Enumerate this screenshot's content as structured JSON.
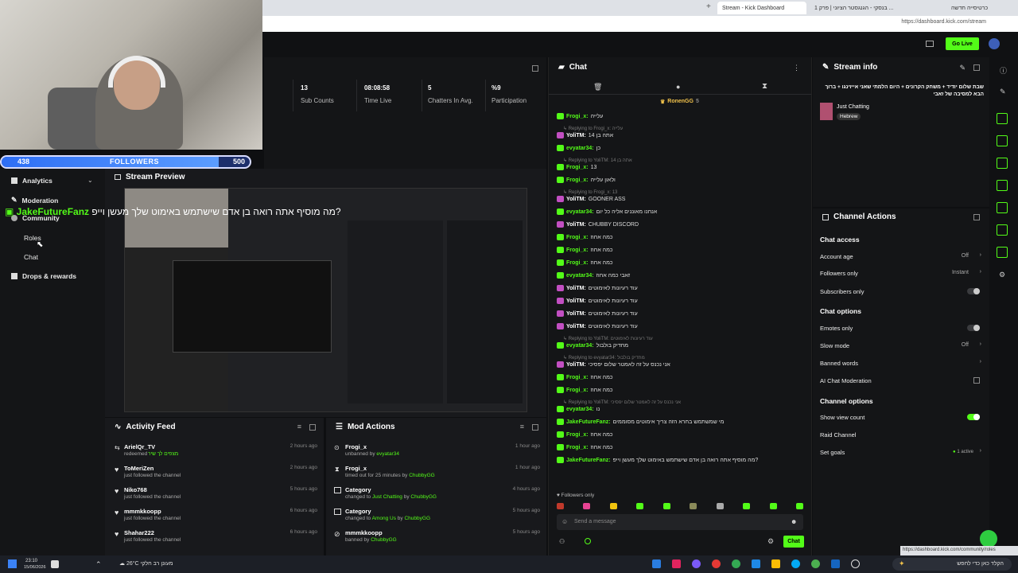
{
  "browser": {
    "tabs": [
      {
        "label": "Stream - Kick Dashboard",
        "active": true
      },
      {
        "label": "בנסקי - הגנגסטר הציוני | פרק 1 ...",
        "active": false
      },
      {
        "label": "כרטיסייה חדשה",
        "active": false
      }
    ],
    "url": "https://dashboard.kick.com/stream",
    "status_url": "https://dashboard.kick.com/community/roles"
  },
  "topbar": {
    "go_live": "Go Live"
  },
  "goal": {
    "current": "438",
    "label": "FOLLOWERS",
    "target": "500",
    "progress": 0.876
  },
  "sidebar": {
    "analytics": "Analytics",
    "moderation": "Moderation",
    "community": "Community",
    "roles": "Roles",
    "chat": "Chat",
    "drops": "Drops & rewards"
  },
  "stats": [
    {
      "value": "13",
      "label": "Sub Counts"
    },
    {
      "value": "08:08:58",
      "label": "Time Live"
    },
    {
      "value": "5",
      "label": "Chatters In Avg."
    },
    {
      "value": "%9",
      "label": "Participation"
    }
  ],
  "preview": {
    "title": "Stream Preview",
    "overlay_name": "JakeFutureFanz",
    "overlay_text": "מה מוסיף אתה רואה בן אדם שישתמש באימוט שלך מעשן וייפ?"
  },
  "activity": {
    "title": "Activity Feed",
    "rows": [
      {
        "name": "ArielQr_TV",
        "sub": "redeemed",
        "sub2": "מצפים לך שיר",
        "time": "2 hours ago"
      },
      {
        "name": "ToMeriZen",
        "sub": "just followed the channel",
        "time": "2 hours ago"
      },
      {
        "name": "Niko768",
        "sub": "just followed the channel",
        "time": "5 hours ago"
      },
      {
        "name": "mmmkkoopp",
        "sub": "just followed the channel",
        "time": "6 hours ago"
      },
      {
        "name": "Shahar222",
        "sub": "just followed the channel",
        "time": "6 hours ago"
      }
    ]
  },
  "mod": {
    "title": "Mod Actions",
    "rows": [
      {
        "name": "Frogi_x",
        "sub": "unbanned by",
        "by": "evyatar34",
        "time": "1 hour ago"
      },
      {
        "name": "Frogi_x",
        "sub": "timed out for 25 minutes by",
        "by": "ChubbyGG",
        "time": "1 hour ago"
      },
      {
        "name": "Category",
        "sub": "changed to",
        "val": "Just Chatting",
        "sub3": "by",
        "by": "ChubbyGG",
        "time": "4 hours ago"
      },
      {
        "name": "Category",
        "sub": "changed to",
        "val": "Among Us",
        "sub3": "by",
        "by": "ChubbyGG",
        "time": "5 hours ago"
      },
      {
        "name": "mmmkkoopp",
        "sub": "banned by",
        "by": "ChubbyGG",
        "time": "5 hours ago"
      }
    ]
  },
  "chat": {
    "title": "Chat",
    "pinned": "RonenGG",
    "pinned_count": "5",
    "messages": [
      {
        "reply": "",
        "user": "Frogi_x",
        "color": "#53fc18",
        "text": "עלייה"
      },
      {
        "reply": "Replying to Frogi_x: עלייה",
        "user": "YoliTM",
        "color": "#ffffff",
        "text": "אתה בן 14"
      },
      {
        "reply": "",
        "user": "evyatar34",
        "color": "#53fc18",
        "text": "כן"
      },
      {
        "reply": "Replying to YoliTM: אתה בן 14",
        "user": "Frogi_x",
        "color": "#53fc18",
        "text": "13"
      },
      {
        "reply": "",
        "user": "Frogi_x",
        "color": "#53fc18",
        "text": "ולאון עלייה"
      },
      {
        "reply": "Replying to Frogi_x: 13",
        "user": "YoliTM",
        "color": "#ffffff",
        "text": "GOONER ASS"
      },
      {
        "reply": "",
        "user": "evyatar34",
        "color": "#53fc18",
        "text": "אנחנו מאוננים אליה כל יום"
      },
      {
        "reply": "",
        "user": "YoliTM",
        "color": "#ffffff",
        "text": "CHUBBY DISCORD"
      },
      {
        "reply": "",
        "user": "Frogi_x",
        "color": "#53fc18",
        "text": "כמה אחוז"
      },
      {
        "reply": "",
        "user": "Frogi_x",
        "color": "#53fc18",
        "text": "כמה אחוז"
      },
      {
        "reply": "",
        "user": "Frogi_x",
        "color": "#53fc18",
        "text": "כמה אחוז"
      },
      {
        "reply": "",
        "user": "evyatar34",
        "color": "#53fc18",
        "text": "זאבי כמה אחוז"
      },
      {
        "reply": "",
        "user": "YoliTM",
        "color": "#ffffff",
        "text": "עוד רעיונות לאימוטים"
      },
      {
        "reply": "",
        "user": "YoliTM",
        "color": "#ffffff",
        "text": "עוד רעיונות לאימוטים"
      },
      {
        "reply": "",
        "user": "YoliTM",
        "color": "#ffffff",
        "text": "עוד רעיונות לאימוטים"
      },
      {
        "reply": "",
        "user": "YoliTM",
        "color": "#ffffff",
        "text": "עוד רעיונות לאימוטים"
      },
      {
        "reply": "Replying to YoliTM: עוד רעיונות לאימוטים",
        "user": "evyatar34",
        "color": "#53fc18",
        "text": "מחדיק בולבול"
      },
      {
        "reply": "Replying to evyatar34: מחדיק בולבול",
        "user": "YoliTM",
        "color": "#ffffff",
        "text": "אני נכנס על זה לאמטר שלום יפסיכי"
      },
      {
        "reply": "",
        "user": "Frogi_x",
        "color": "#53fc18",
        "text": "כמה אחוז"
      },
      {
        "reply": "",
        "user": "Frogi_x",
        "color": "#53fc18",
        "text": "כמה אחוז"
      },
      {
        "reply": "Replying to YoliTM: אני נכנס על זה לאמטר שלום יפסיכי",
        "user": "evyatar34",
        "color": "#53fc18",
        "text": "נו"
      },
      {
        "reply": "",
        "user": "JakeFutureFanz",
        "color": "#53fc18",
        "text": "מי שמשתמש בחרא הזה צריך אימוטים מסוממים"
      },
      {
        "reply": "",
        "user": "Frogi_x",
        "color": "#53fc18",
        "text": "כמה אחוז"
      },
      {
        "reply": "",
        "user": "Frogi_x",
        "color": "#53fc18",
        "text": "כמה אחוז"
      },
      {
        "reply": "",
        "user": "JakeFutureFanz",
        "color": "#53fc18",
        "text": "מה מוסיף אתה רואה בן אדם שישתמש באימוט שלך מעשן וייפ?"
      }
    ],
    "followers_only": "Followers only",
    "placeholder": "Send a message",
    "send": "Chat"
  },
  "stream_info": {
    "title": "Stream info",
    "stream_title": "שבת שלום יודיד + משחק הקרונים + היום הלמתי שאני אייזינגו + ברוך הבא למסיבה של זאבי",
    "category": "Just Chatting",
    "language": "Hebrew"
  },
  "channel_actions": {
    "title": "Channel Actions",
    "chat_access": "Chat access",
    "account_age": "Account age",
    "account_age_val": "Off",
    "followers_only": "Followers only",
    "followers_only_val": "Instant",
    "subscribers_only": "Subscribers only",
    "chat_options": "Chat options",
    "emotes_only": "Emotes only",
    "slow_mode": "Slow mode",
    "slow_mode_val": "Off",
    "banned_words": "Banned words",
    "ai_mod": "AI Chat Moderation",
    "channel_options": "Channel options",
    "show_view_count": "Show view count",
    "raid_channel": "Raid Channel",
    "set_goals": "Set goals",
    "set_goals_val": "1 active"
  },
  "taskbar": {
    "time": "23:10",
    "date": "15/06/2026",
    "weather_temp": "26°C",
    "weather_desc": "מעונן רב חלקי",
    "search": "הקלד כאן כדי לחפש"
  },
  "colors": {
    "accent": "#53fc18",
    "bg": "#0e0f11",
    "panel": "#141517"
  }
}
